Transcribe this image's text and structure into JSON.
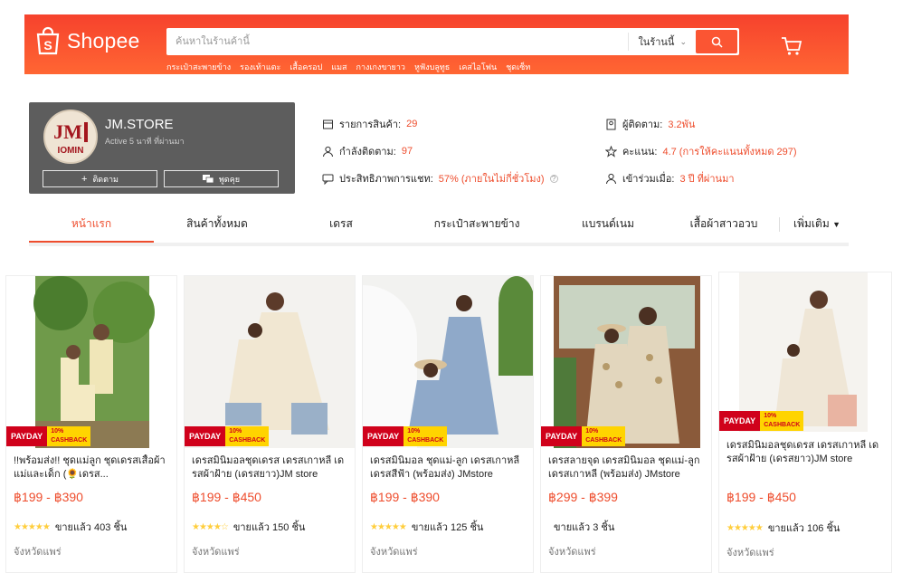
{
  "header": {
    "logo_text": "Shopee",
    "search_placeholder": "ค้นหาในร้านค้านี้",
    "search_scope": "ในร้านนี้",
    "hot_words": [
      "กระเป๋าสะพายข้าง",
      "รองเท้าแตะ",
      "เสื้อครอป",
      "แมส",
      "กางเกงขายาว",
      "หูฟังบลูทูธ",
      "เคสไอโฟน",
      "ชุดเซ็ท"
    ]
  },
  "shop": {
    "name": "JM.STORE",
    "active": "Active 5 นาที ที่ผ่านมา",
    "follow_label": "ติดตาม",
    "chat_label": "พูดคุย",
    "logo_text": "JM IOMIN"
  },
  "stats": {
    "products_label": "รายการสินค้า:",
    "products_value": "29",
    "following_label": "กำลังติดตาม:",
    "following_value": "97",
    "chat_label": "ประสิทธิภาพการแชท:",
    "chat_value": "57% (ภายในไม่กี่ชั่วโมง)",
    "followers_label": "ผู้ติดตาม:",
    "followers_value": "3.2พัน",
    "rating_label": "คะแนน:",
    "rating_value": "4.7 (การให้คะแนนทั้งหมด 297)",
    "joined_label": "เข้าร่วมเมื่อ:",
    "joined_value": "3 ปี ที่ผ่านมา"
  },
  "nav": {
    "tabs": [
      "หน้าแรก",
      "สินค้าทั้งหมด",
      "เดรส",
      "กระเป๋าสะพายข้าง",
      "แบรนด์เนม",
      "เสื้อผ้าสาวอวบ"
    ],
    "more": "เพิ่มเติม"
  },
  "badge": {
    "payday": "PAYDAY",
    "cashback_line1": "10%",
    "cashback_line2": "CASHBACK"
  },
  "products": [
    {
      "title": "!!พร้อมส่ง!! ชุดแม่ลูก ชุดเดรสเสื้อผ้าแม่และเด็ก (🌻เดรส...",
      "price": "฿199 - ฿390",
      "stars": "★★★★★",
      "sold": "ขายแล้ว 403 ชิ้น",
      "location": "จังหวัดแพร่"
    },
    {
      "title": "เดรสมินิมอลชุดเดรส เดรสเกาหลี เดรสผ้าฝ้าย (เดรสยาว)JM store",
      "price": "฿199 - ฿450",
      "stars": "★★★★☆",
      "sold": "ขายแล้ว 150 ชิ้น",
      "location": "จังหวัดแพร่"
    },
    {
      "title": "เดรสมินิมอล ชุดแม่-ลูก เดรสเกาหลีเดรสสีฟ้า (พร้อมส่ง) JMstore",
      "price": "฿199 - ฿390",
      "stars": "★★★★★",
      "sold": "ขายแล้ว 125 ชิ้น",
      "location": "จังหวัดแพร่"
    },
    {
      "title": "เดรสลายจุด เดรสมินิมอล ชุดแม่-ลูก เดรสเกาหลี (พร้อมส่ง) JMstore",
      "price": "฿299 - ฿399",
      "stars": "",
      "sold": "ขายแล้ว 3 ชิ้น",
      "location": "จังหวัดแพร่"
    },
    {
      "title": "เดรสมินิมอลชุดเดรส เดรสเกาหลี เดรสผ้าฝ้าย (เดรสยาว)JM store",
      "price": "฿199 - ฿450",
      "stars": "★★★★★",
      "sold": "ขายแล้ว 106 ชิ้น",
      "location": "จังหวัดแพร่"
    }
  ]
}
